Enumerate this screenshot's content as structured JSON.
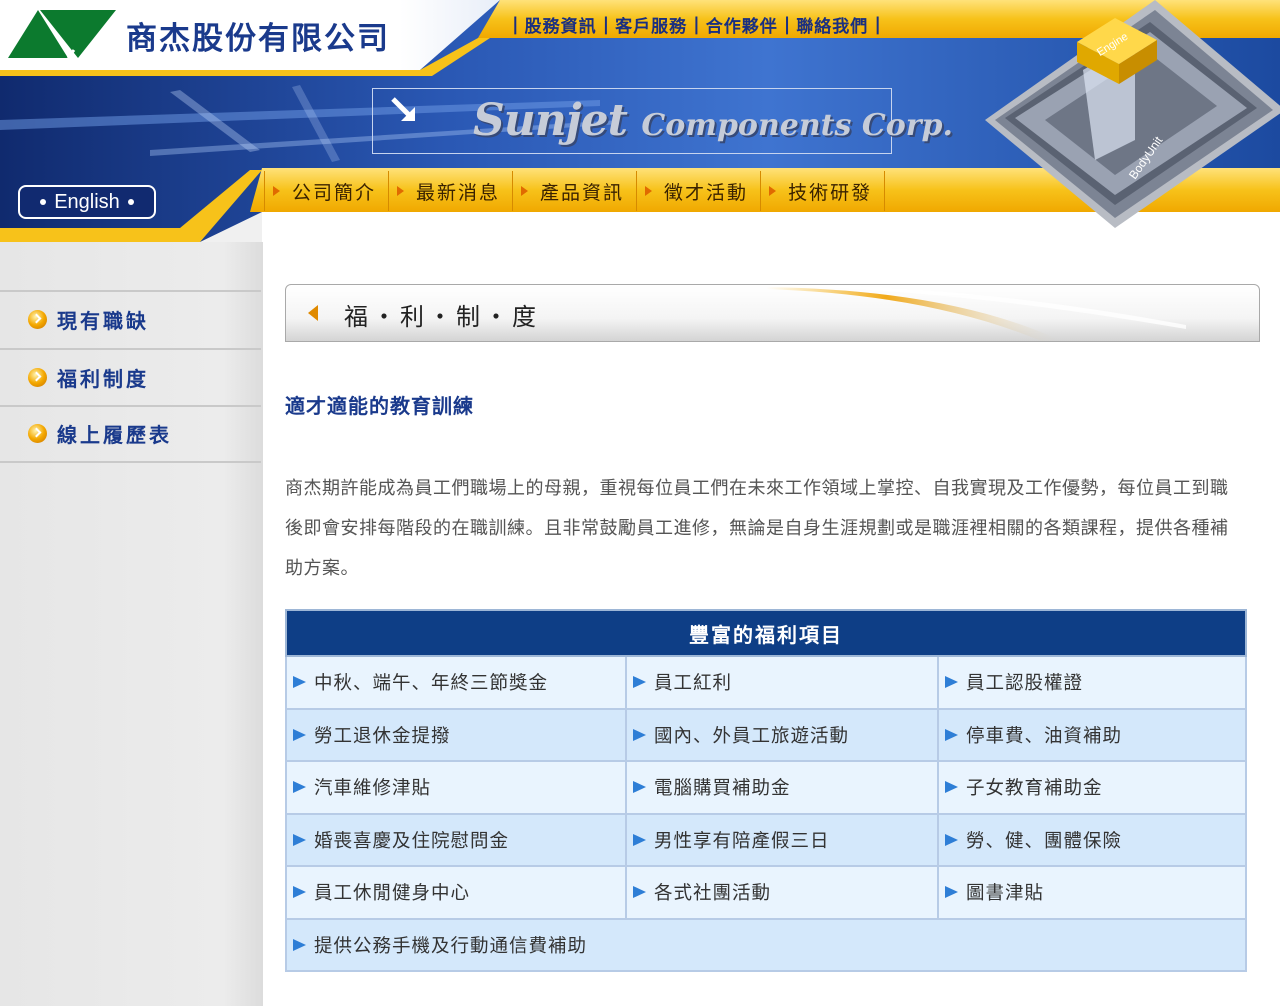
{
  "header": {
    "company_name": "商杰股份有限公司",
    "brand_main": "Sunjet",
    "brand_sub": "Components Corp.",
    "top_nav": [
      "股務資訊",
      "客戶服務",
      "合作夥伴",
      "聯絡我們"
    ],
    "english_button": "English",
    "main_nav": [
      "公司簡介",
      "最新消息",
      "產品資訊",
      "徵才活動",
      "技術研發"
    ],
    "chip_labels": {
      "top": "Engine",
      "side": "BodyUnit"
    }
  },
  "sidebar": {
    "items": [
      {
        "label": "現有職缺"
      },
      {
        "label": "福利制度"
      },
      {
        "label": "線上履歷表"
      }
    ]
  },
  "content": {
    "banner_title": "福・利・制・度",
    "sub_heading": "適才適能的教育訓練",
    "intro": "商杰期許能成為員工們職場上的母親，重視每位員工們在未來工作領域上掌控、自我實現及工作優勢，每位員工到職後即會安排每階段的在職訓練。且非常鼓勵員工進修，無論是自身生涯規劃或是職涯裡相關的各類課程，提供各種補助方案。",
    "table": {
      "header": "豐富的福利項目",
      "rows": [
        [
          "中秋、端午、年終三節獎金",
          "員工紅利",
          "員工認股權證"
        ],
        [
          "勞工退休金提撥",
          "國內、外員工旅遊活動",
          "停車費、油資補助"
        ],
        [
          "汽車維修津貼",
          "電腦購買補助金",
          "子女教育補助金"
        ],
        [
          "婚喪喜慶及住院慰問金",
          "男性享有陪產假三日",
          "勞、健、團體保險"
        ],
        [
          "員工休閒健身中心",
          "各式社團活動",
          "圖書津貼"
        ]
      ],
      "last_row": "提供公務手機及行動通信費補助"
    }
  },
  "colors": {
    "nav_yellow": "#f7c21a",
    "brand_blue": "#1a3a8c",
    "table_header": "#0e3e86",
    "row_light": "#e9f4fe",
    "row_dark": "#d4e8fb",
    "arrow_blue": "#2e7ed6"
  }
}
